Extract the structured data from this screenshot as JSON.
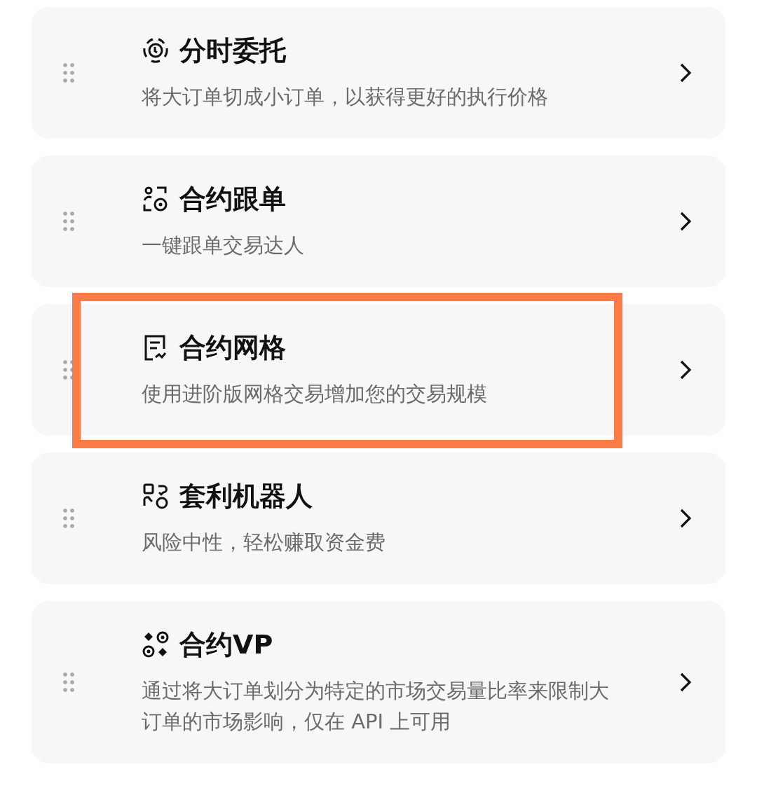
{
  "items": [
    {
      "title": "分时委托",
      "description": "将大订单切成小订单，以获得更好的执行价格",
      "highlighted": false
    },
    {
      "title": "合约跟单",
      "description": "一键跟单交易达人",
      "highlighted": false
    },
    {
      "title": "合约网格",
      "description": "使用进阶版网格交易增加您的交易规模",
      "highlighted": true
    },
    {
      "title": "套利机器人",
      "description": "风险中性，轻松赚取资金费",
      "highlighted": false
    },
    {
      "title": "合约VP",
      "description": "通过将大订单划分为特定的市场交易量比率来限制大订单的市场影响，仅在 API 上可用",
      "highlighted": false
    }
  ]
}
